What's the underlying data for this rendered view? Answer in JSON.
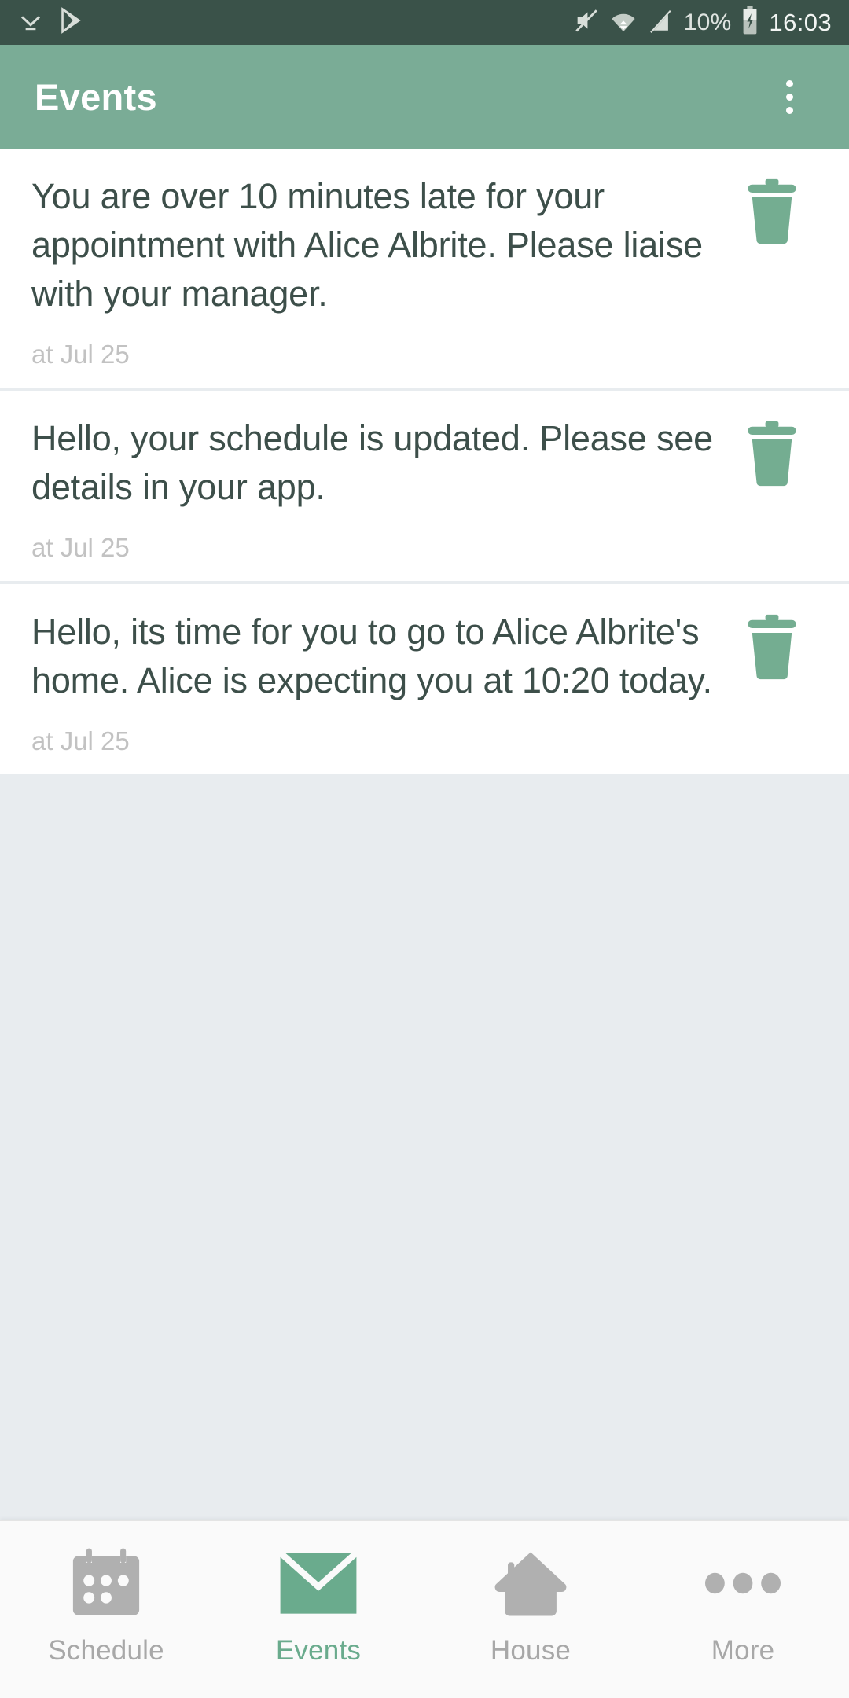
{
  "status_bar": {
    "icons": [
      "download-done-icon",
      "play-store-icon",
      "volume-mute-icon",
      "wifi-icon",
      "signal-off-icon",
      "battery-charging-icon"
    ],
    "battery_percent": "10%",
    "clock": "16:03"
  },
  "app_bar": {
    "title": "Events",
    "overflow_label": "overflow-menu"
  },
  "events": [
    {
      "message": "You are over 10 minutes late for your appointment with Alice Albrite. Please liaise with your manager.",
      "time": "at Jul 25",
      "delete_label": "delete-event"
    },
    {
      "message": "Hello, your schedule is updated. Please see details in your app.",
      "time": "at Jul 25",
      "delete_label": "delete-event"
    },
    {
      "message": "Hello, its time for you to go to Alice Albrite's home. Alice is expecting you at 10:20 today.",
      "time": "at Jul 25",
      "delete_label": "delete-event"
    }
  ],
  "bottom_nav": {
    "items": [
      {
        "label": "Schedule",
        "icon": "calendar-icon",
        "active": false
      },
      {
        "label": "Events",
        "icon": "envelope-icon",
        "active": true
      },
      {
        "label": "House",
        "icon": "house-icon",
        "active": false
      },
      {
        "label": "More",
        "icon": "more-dots-icon",
        "active": false
      }
    ]
  },
  "colors": {
    "status_bar_bg": "#3a5249",
    "app_bar_bg": "#7aac96",
    "accent_green": "#6aab8d",
    "card_bg": "#ffffff",
    "page_bg": "#e8ecef",
    "text_primary": "#3d4f4a",
    "text_muted": "#c2c2c2",
    "nav_inactive": "#a8a8a8",
    "nav_bg": "#fafafa"
  }
}
